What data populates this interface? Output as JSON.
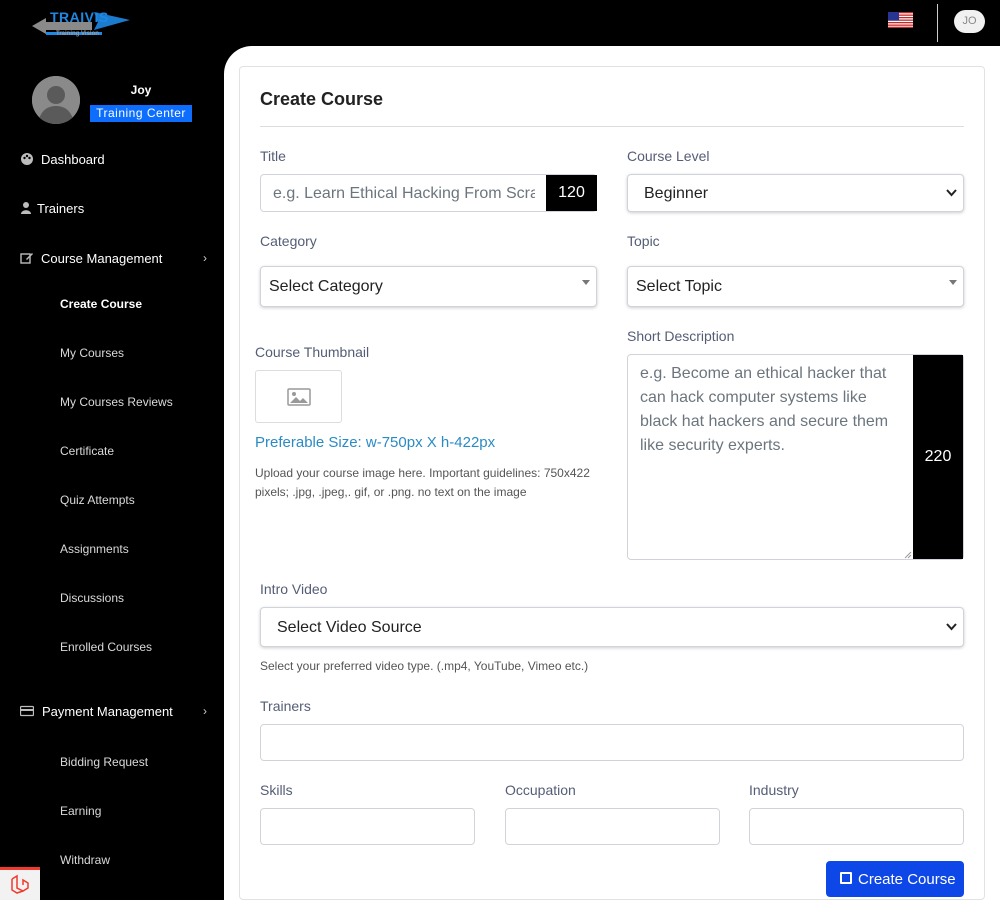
{
  "header": {
    "logo_text": "TRAIVIS",
    "logo_sub": "Training Vision",
    "language_flag": "us-flag-icon",
    "user_initials": "JO"
  },
  "profile": {
    "name": "Joy",
    "role": "Training Center"
  },
  "sidebar": {
    "items": [
      {
        "label": "Dashboard",
        "icon": "palette-icon"
      },
      {
        "label": "Trainers",
        "icon": "user-icon"
      },
      {
        "label": "Course Management",
        "icon": "edit-icon"
      },
      {
        "label": "Payment Management",
        "icon": "credit-card-icon"
      }
    ],
    "course_sub": [
      "Create Course",
      "My Courses",
      "My Courses Reviews",
      "Certificate",
      "Quiz Attempts",
      "Assignments",
      "Discussions",
      "Enrolled Courses"
    ],
    "payment_sub": [
      "Bidding Request",
      "Earning",
      "Withdraw"
    ]
  },
  "form": {
    "title": "Create Course",
    "title_label": "Title",
    "title_placeholder": "e.g. Learn Ethical Hacking From Scratch",
    "title_counter": "120",
    "level_label": "Course Level",
    "level_value": "Beginner",
    "category_label": "Category",
    "category_value": "Select Category",
    "topic_label": "Topic",
    "topic_value": "Select Topic",
    "thumbnail_label": "Course Thumbnail",
    "preferable_size": "Preferable Size: w-750px X h-422px",
    "thumbnail_help": "Upload your course image here. Important guidelines: 750x422 pixels; .jpg, .jpeg,. gif, or .png. no text on the image",
    "short_desc_label": "Short Description",
    "short_desc_placeholder": "e.g. Become an ethical hacker that can hack computer systems like black hat hackers and secure them like security experts.",
    "short_desc_counter": "220",
    "intro_video_label": "Intro Video",
    "intro_video_value": "Select Video Source",
    "intro_video_help": "Select your preferred video type. (.mp4, YouTube, Vimeo etc.)",
    "trainers_label": "Trainers",
    "skills_label": "Skills",
    "occupation_label": "Occupation",
    "industry_label": "Industry",
    "submit_label": "Create Course"
  }
}
